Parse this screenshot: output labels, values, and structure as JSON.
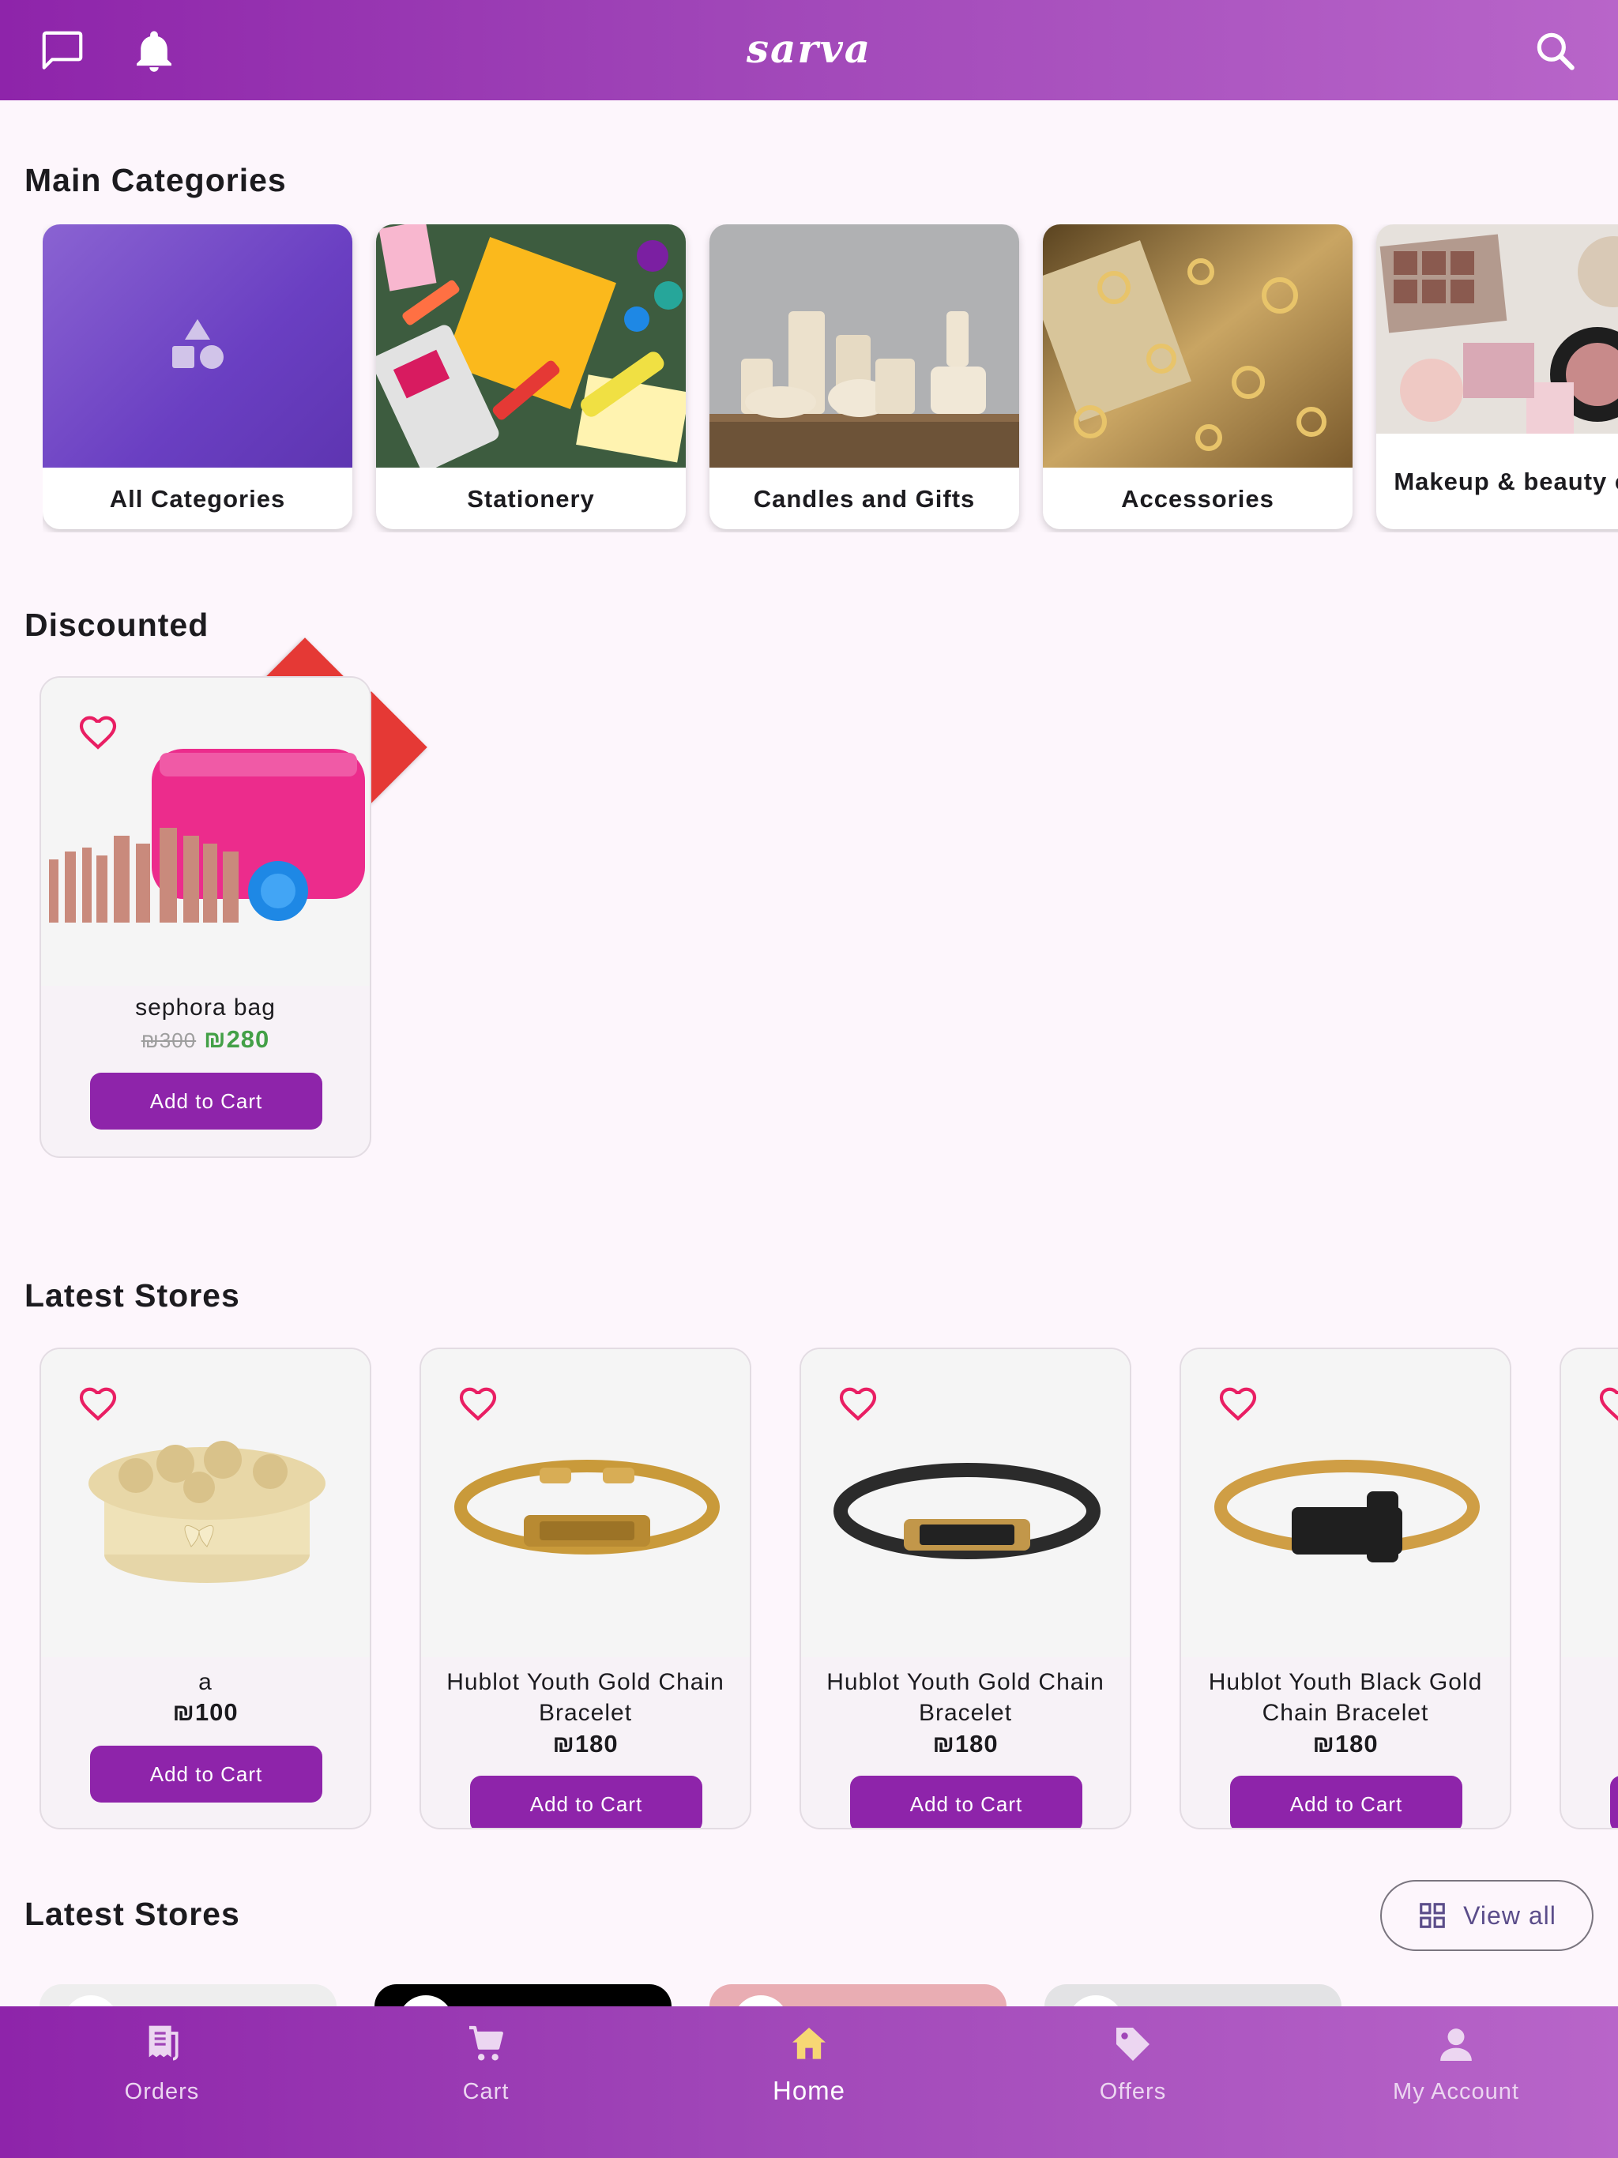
{
  "app": {
    "logo": "sarva",
    "icons": {
      "chat": "chat-icon",
      "notifications": "bell-icon",
      "search": "search-icon"
    },
    "colors": {
      "primary": "#8e24aa",
      "accent_light": "#b865c9",
      "sale_badge": "#e53935",
      "sale_price": "#43a047",
      "heart": "#e91e63"
    }
  },
  "categories": {
    "title": "Main Categories",
    "items": [
      {
        "label": "All Categories",
        "icon": "shapes-icon"
      },
      {
        "label": "Stationery"
      },
      {
        "label": "Candles and Gifts"
      },
      {
        "label": "Accessories"
      },
      {
        "label": "Makeup & beauty care"
      }
    ]
  },
  "discounted": {
    "title": "Discounted",
    "items": [
      {
        "name": "sephora bag",
        "old_price": "₪300",
        "price": "₪280",
        "button": "Add to Cart"
      }
    ]
  },
  "latest_products": {
    "title": "Latest Stores",
    "items": [
      {
        "name": "a",
        "price": "₪100",
        "button": "Add to Cart"
      },
      {
        "name": "Hublot Youth Gold Chain Bracelet",
        "price": "₪180",
        "button": "Add to Cart"
      },
      {
        "name": "Hublot Youth Gold Chain Bracelet",
        "price": "₪180",
        "button": "Add to Cart"
      },
      {
        "name": "Hublot Youth Black  Gold Chain Bracelet",
        "price": "₪180",
        "button": "Add to Cart"
      }
    ]
  },
  "latest_stores": {
    "title": "Latest Stores",
    "view_all": "View all"
  },
  "bottom_nav": {
    "items": [
      {
        "label": "Orders",
        "icon": "receipt-icon"
      },
      {
        "label": "Cart",
        "icon": "cart-icon"
      },
      {
        "label": "Home",
        "icon": "home-icon",
        "active": true
      },
      {
        "label": "Offers",
        "icon": "tag-icon"
      },
      {
        "label": "My Account",
        "icon": "person-icon"
      }
    ]
  }
}
